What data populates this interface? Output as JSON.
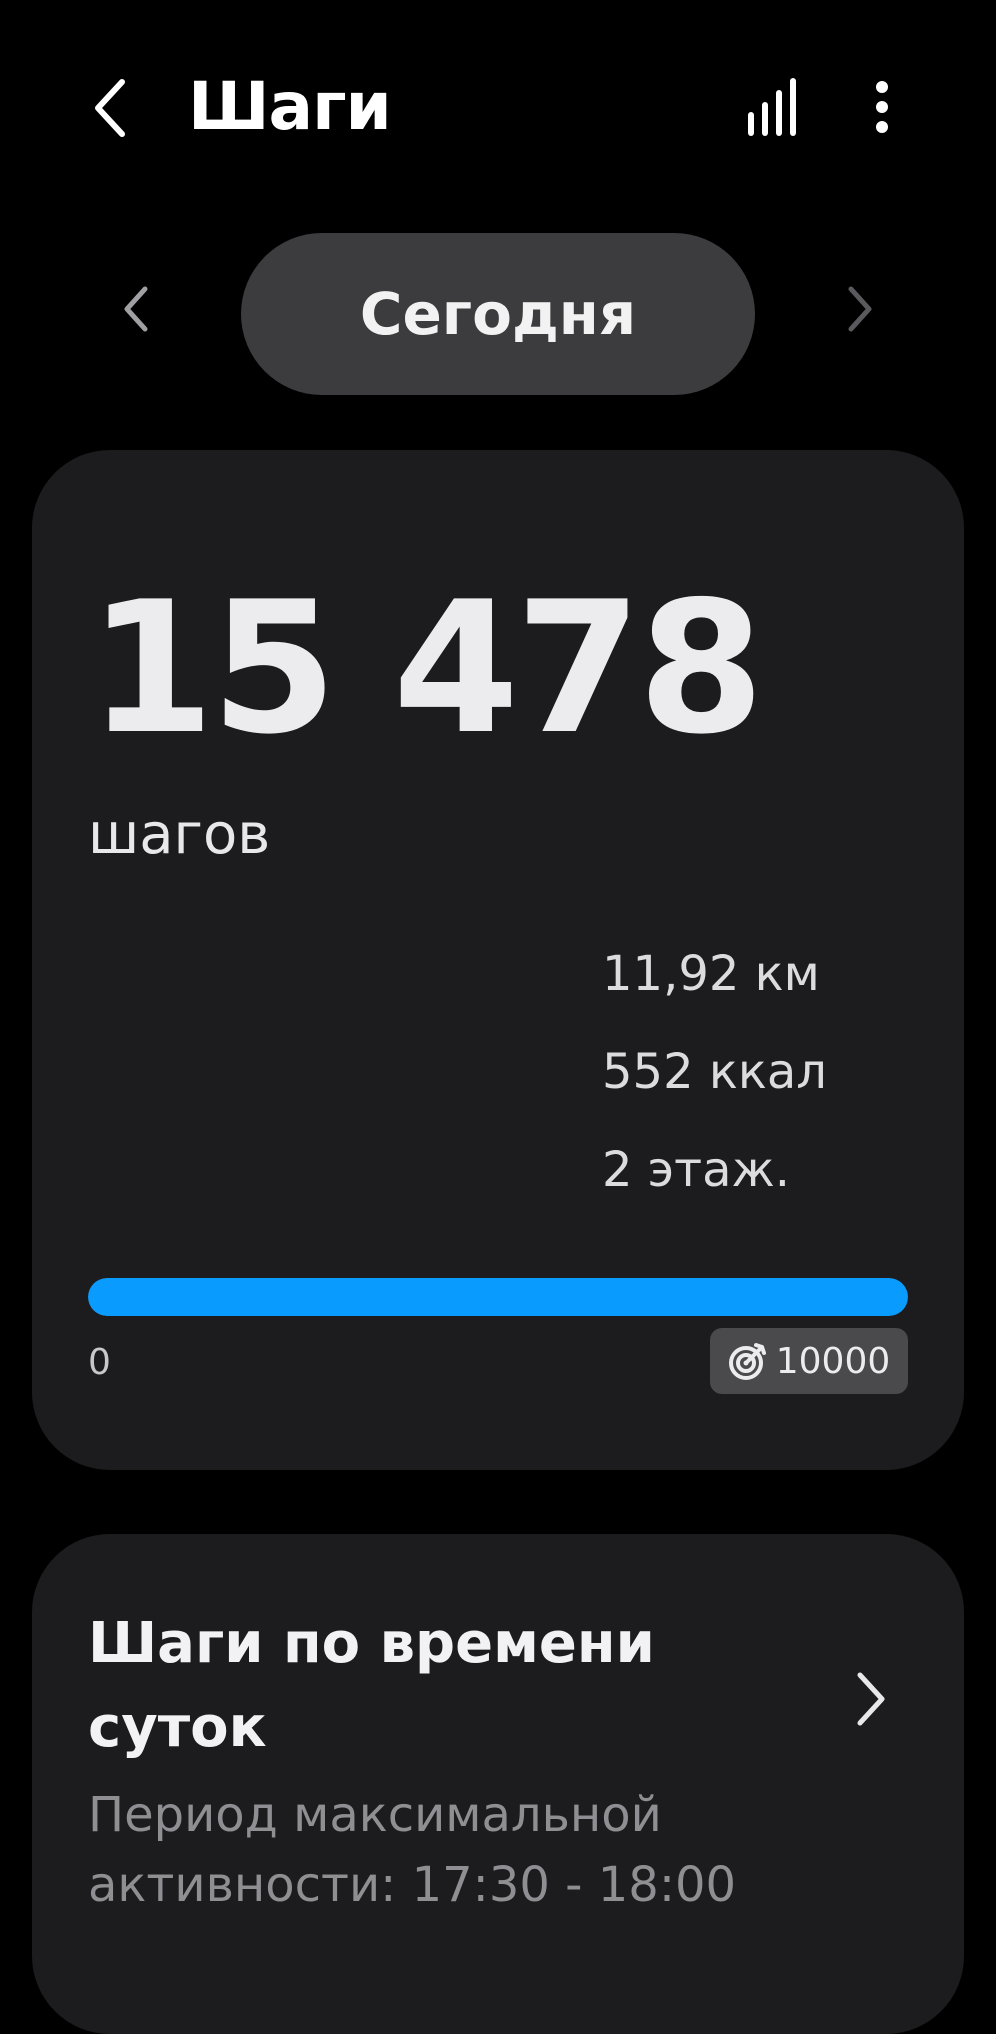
{
  "header": {
    "title": "Шаги",
    "back_icon": "chevron-left-icon",
    "chart_icon": "bar-chart-icon",
    "more_icon": "more-vertical-icon"
  },
  "date_selector": {
    "label": "Сегодня",
    "prev_icon": "chevron-left-icon",
    "next_icon": "chevron-right-icon"
  },
  "steps_card": {
    "count": "15 478",
    "unit": "шагов",
    "distance": "11,92 км",
    "calories": "552 ккал",
    "floors": "2 этаж.",
    "progress_min": "0",
    "goal": "10000",
    "goal_icon": "target-icon",
    "progress_fraction": 1.0
  },
  "hourly_card": {
    "title": "Шаги по времени суток",
    "subtitle": "Период максимальной активности: 17:30 - 18:00",
    "chevron_icon": "chevron-right-icon"
  },
  "colors": {
    "background": "#000000",
    "card": "#1c1c1e",
    "pill": "#3c3c3f",
    "accent": "#0a9bff",
    "badge": "#4a4a4d",
    "muted_text": "#8e8e93"
  }
}
